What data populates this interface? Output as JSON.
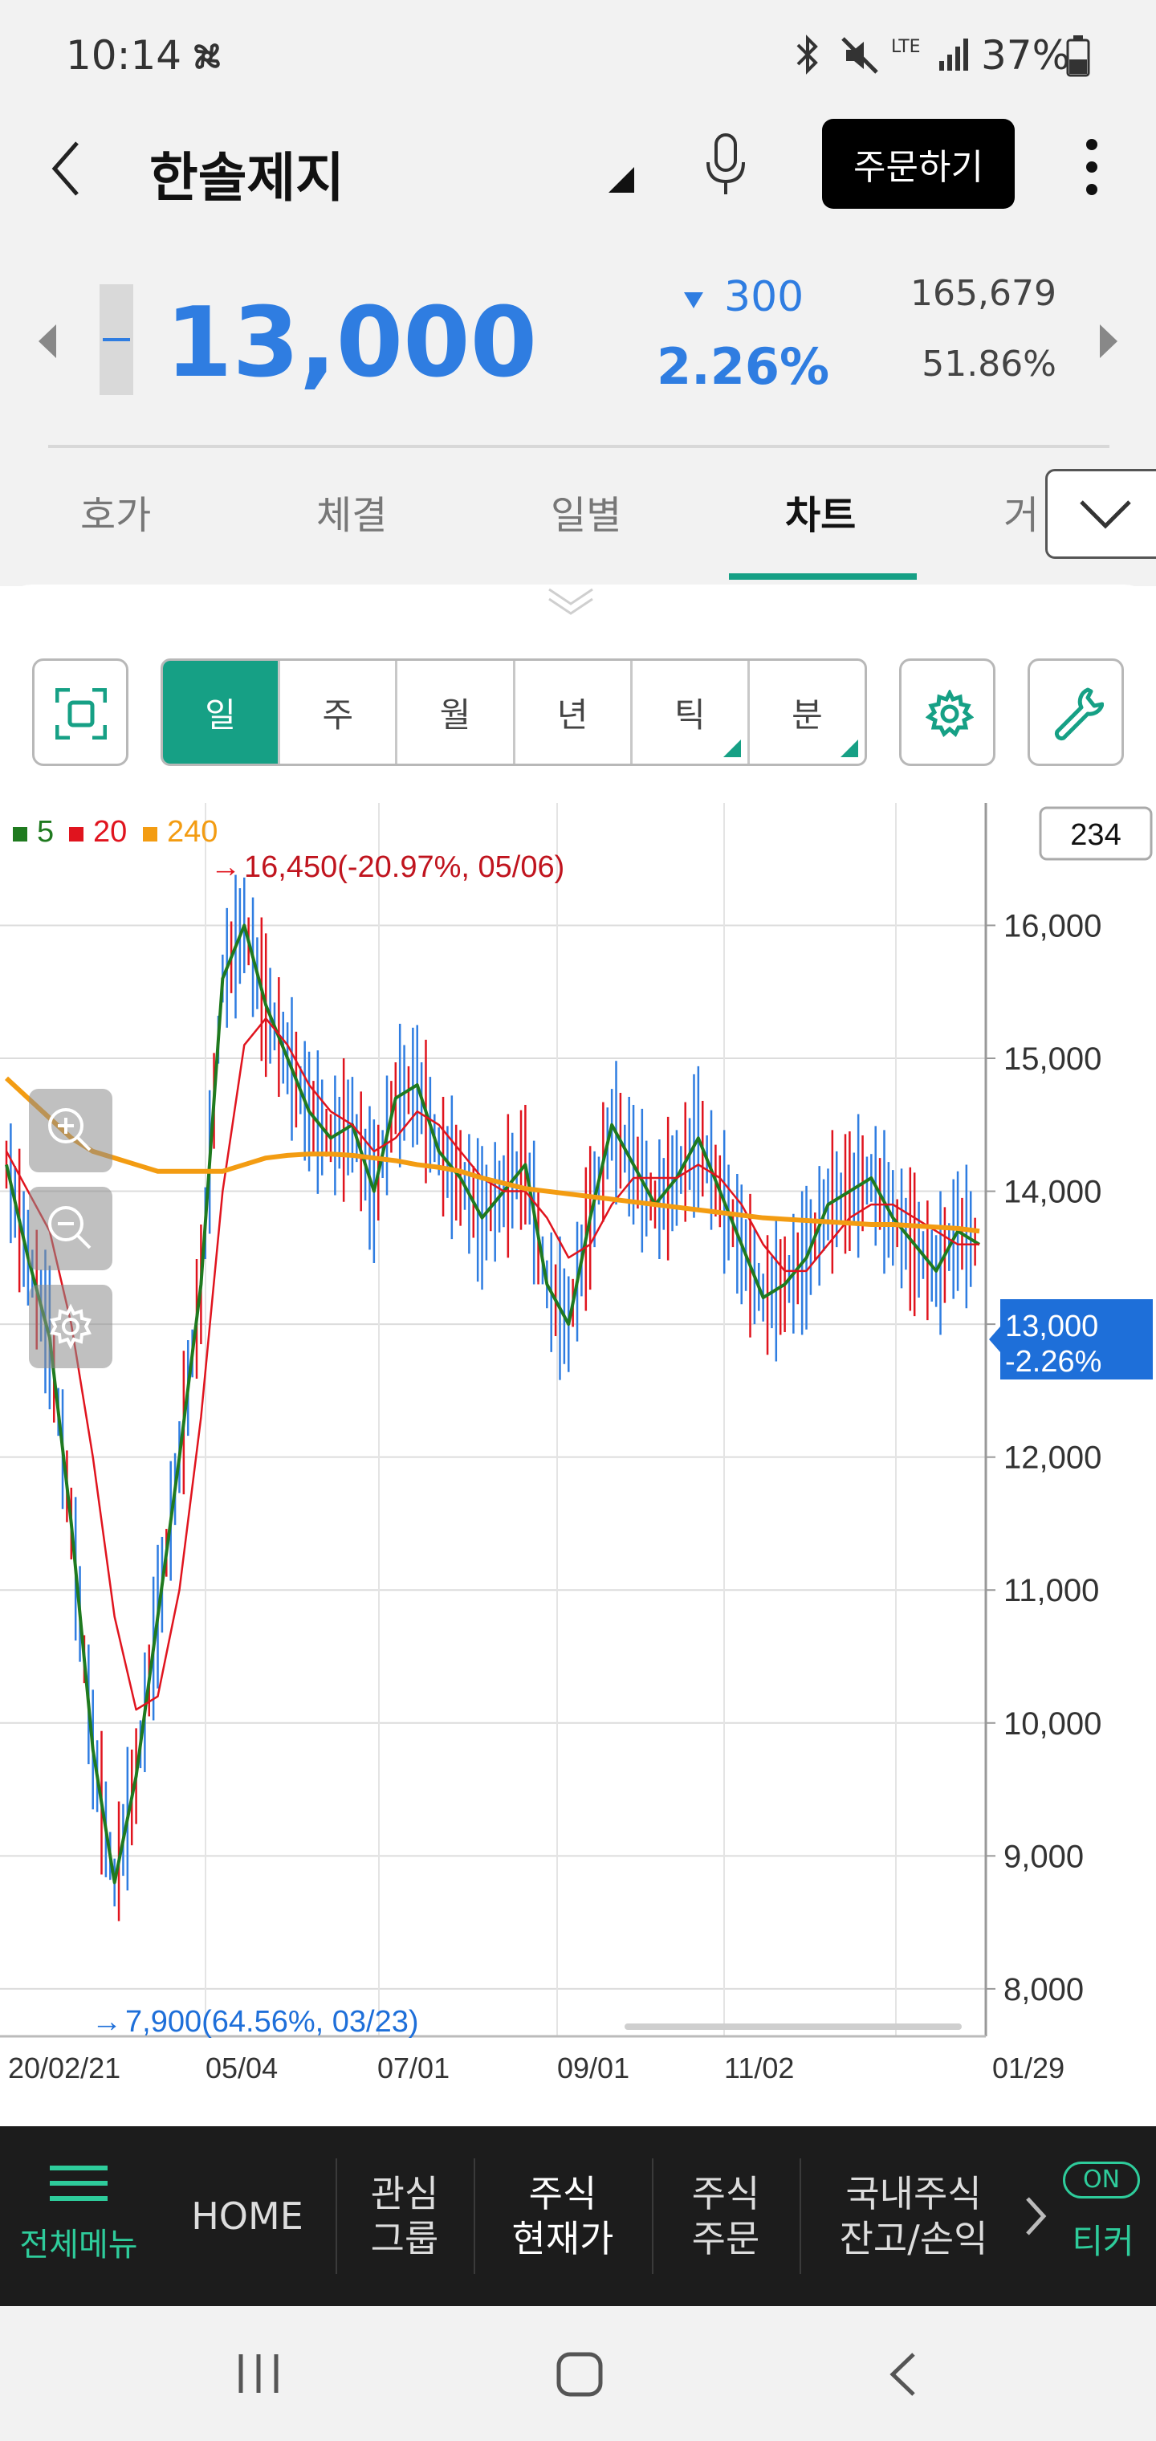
{
  "status": {
    "time": "10:14",
    "battery": "37%",
    "network": "LTE"
  },
  "header": {
    "title": "한솔제지",
    "order_label": "주문하기"
  },
  "price": {
    "current": "13,000",
    "change": "300",
    "change_pct": "2.26%",
    "volume": "165,679",
    "volume_ratio": "51.86%",
    "color": "#2f7de1"
  },
  "tabs": [
    "호가",
    "체결",
    "일별",
    "차트",
    "거"
  ],
  "active_tab": "차트",
  "periods": [
    "일",
    "주",
    "월",
    "년",
    "틱",
    "분"
  ],
  "active_period": "일",
  "chart": {
    "legend": [
      {
        "label": "5",
        "color": "#1f7a1f"
      },
      {
        "label": "20",
        "color": "#e0141e"
      },
      {
        "label": "240",
        "color": "#f39c12"
      }
    ],
    "count_box": "234",
    "high_note": "16,450(-20.97%, 05/06)",
    "low_note": "7,900(64.56%, 03/23)",
    "current_tag": "13,000",
    "current_tag_pct": "-2.26%",
    "current_tag_color": "#1e6fd9"
  },
  "chart_data": {
    "type": "line",
    "title": "",
    "ylim": [
      7800,
      16800
    ],
    "y_ticks": [
      "16,000",
      "15,000",
      "14,000",
      "13,000",
      "12,000",
      "11,000",
      "10,000",
      "9,000",
      "8,000"
    ],
    "x_ticks": [
      "20/02/21",
      "05/04",
      "07/01",
      "09/01",
      "11/02",
      "01/29"
    ],
    "series": [
      {
        "name": "5",
        "values": [
          14200,
          13500,
          12900,
          11500,
          9800,
          8800,
          9600,
          10800,
          12000,
          13300,
          15600,
          16000,
          15400,
          15000,
          14600,
          14400,
          14500,
          14000,
          14700,
          14800,
          14300,
          14100,
          13800,
          14000,
          14200,
          13300,
          13000,
          13800,
          14500,
          14200,
          13900,
          14100,
          14400,
          14000,
          13600,
          13200,
          13300,
          13500,
          13900,
          14000,
          14100,
          13800,
          13600,
          13400,
          13700,
          13600
        ]
      },
      {
        "name": "20",
        "values": [
          14300,
          14000,
          13700,
          13000,
          12000,
          10800,
          10100,
          10200,
          11000,
          12300,
          14000,
          15100,
          15300,
          15100,
          14800,
          14600,
          14500,
          14300,
          14400,
          14600,
          14500,
          14300,
          14100,
          14000,
          14000,
          13800,
          13500,
          13600,
          13900,
          14100,
          14100,
          14100,
          14200,
          14100,
          13900,
          13600,
          13400,
          13400,
          13600,
          13800,
          13900,
          13900,
          13800,
          13700,
          13600,
          13600
        ]
      },
      {
        "name": "240",
        "values": [
          14850,
          14700,
          14550,
          14400,
          14300,
          14250,
          14200,
          14150,
          14150,
          14150,
          14150,
          14200,
          14250,
          14270,
          14280,
          14280,
          14270,
          14250,
          14230,
          14200,
          14180,
          14150,
          14100,
          14060,
          14020,
          14000,
          13980,
          13960,
          13940,
          13920,
          13900,
          13880,
          13860,
          13840,
          13820,
          13800,
          13790,
          13780,
          13770,
          13760,
          13750,
          13750,
          13740,
          13730,
          13720,
          13700
        ]
      }
    ],
    "annotations": [
      {
        "text": "16,450(-20.97%, 05/06)",
        "y": 16450
      },
      {
        "text": "7,900(64.56%, 03/23)",
        "y": 7900
      }
    ],
    "current_value": 13000
  },
  "bottom_nav": {
    "menu_label": "전체메뉴",
    "items": [
      "HOME",
      "관심\n그룹",
      "주식\n현재가",
      "주식\n주문",
      "국내주식\n잔고/손익"
    ],
    "active": "주식\n현재가",
    "ticker_on": "ON",
    "ticker_label": "티커"
  }
}
